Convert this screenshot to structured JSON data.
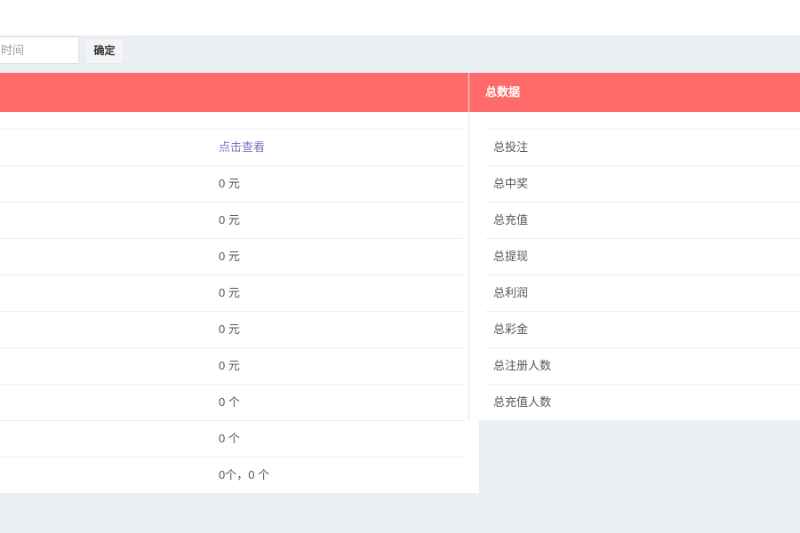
{
  "filter": {
    "time_placeholder": "时间",
    "confirm_label": "确定"
  },
  "left_panel": {
    "header": "",
    "rows": [
      {
        "value": "点击查看"
      },
      {
        "value": "0 元"
      },
      {
        "value": "0 元"
      },
      {
        "value": "0 元"
      },
      {
        "value": "0 元"
      },
      {
        "value": "0 元"
      },
      {
        "value": "0 元"
      },
      {
        "value": "0 个"
      },
      {
        "value": "0 个"
      },
      {
        "value": "0个，0 个"
      }
    ]
  },
  "right_panel": {
    "header": "总数据",
    "rows": [
      {
        "label": "总投注"
      },
      {
        "label": "总中奖"
      },
      {
        "label": "总充值"
      },
      {
        "label": "总提现"
      },
      {
        "label": "总利润"
      },
      {
        "label": "总彩金"
      },
      {
        "label": "总注册人数"
      },
      {
        "label": "总充值人数"
      }
    ]
  },
  "colors": {
    "header_bg": "#ff6a6a",
    "link": "#8a6fbf",
    "page_bg": "#ebeef2"
  }
}
